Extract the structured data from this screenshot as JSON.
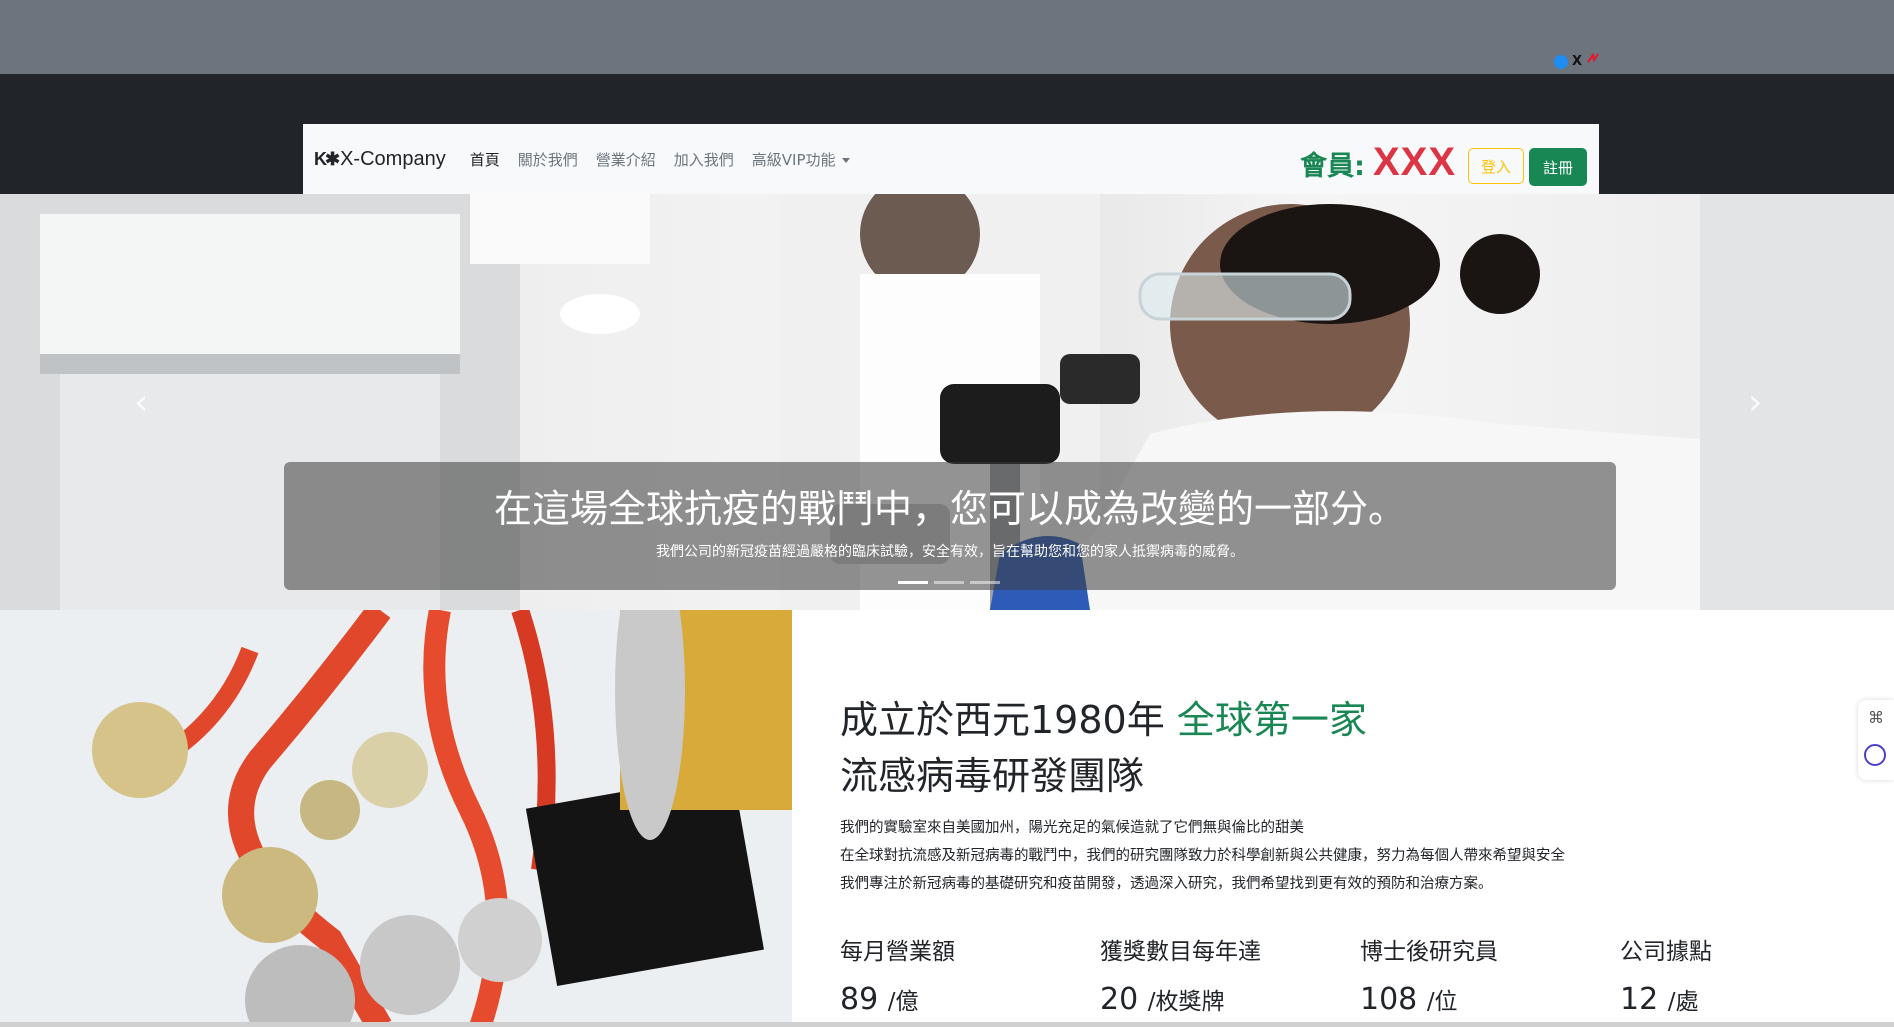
{
  "social": {
    "icons": [
      "facebook-icon",
      "x-icon",
      "weibo-icon"
    ],
    "x_glyph": "X"
  },
  "navbar": {
    "brand_mark": "K✱",
    "brand": "X-Company",
    "items": [
      {
        "label": "首頁",
        "active": true
      },
      {
        "label": "關於我們"
      },
      {
        "label": "營業介紹"
      },
      {
        "label": "加入我們"
      },
      {
        "label": "高級VIP功能",
        "dropdown": true
      }
    ],
    "member_label": "會員:",
    "member_name": "XXX",
    "login": "登入",
    "register": "註冊"
  },
  "carousel": {
    "prev": "‹",
    "next": "›",
    "title": "在這場全球抗疫的戰鬥中，您可以成為改變的一部分。",
    "subtitle": "我們公司的新冠疫苗經過嚴格的臨床試驗，安全有效，旨在幫助您和您的家人抵禦病毒的威脅。",
    "slides": 3,
    "active_slide": 1
  },
  "about": {
    "title_part1": "成立於西元1980年",
    "title_highlight": "全球第一家",
    "title_line2": "流感病毒研發團隊",
    "paragraphs": [
      "我們的實驗室來自美國加州，陽光充足的氣候造就了它們無與倫比的甜美",
      "在全球對抗流感及新冠病毒的戰鬥中，我們的研究團隊致力於科學創新與公共健康，努力為每個人帶來希望與安全",
      "我們專注於新冠病毒的基礎研究和疫苗開發，透過深入研究，我們希望找到更有效的預防和治療方案。"
    ]
  },
  "stats": [
    {
      "label": "每月營業額",
      "value": "89",
      "unit": "/億"
    },
    {
      "label": "獲獎數目每年達",
      "value": "20",
      "unit": "/枚獎牌"
    },
    {
      "label": "博士後研究員",
      "value": "108",
      "unit": "/位"
    },
    {
      "label": "公司據點",
      "value": "12",
      "unit": "/處"
    }
  ],
  "colors": {
    "green": "#198754",
    "red": "#dc3545",
    "yellow": "#ffc107",
    "topbar": "#6c757d",
    "dark": "#212529"
  }
}
